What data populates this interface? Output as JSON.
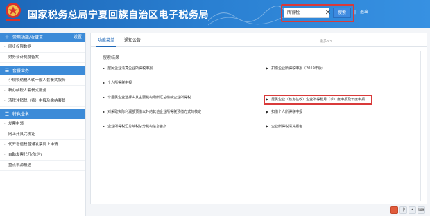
{
  "header": {
    "title": "国家税务总局宁夏回族自治区电子税务局",
    "search_value": "所得税",
    "search_button": "搜索",
    "user_links": [
      "|",
      "退出"
    ]
  },
  "sidebar": {
    "section1": {
      "title": "常用功能/收藏夹",
      "manage": "设置",
      "items": [
        "同步权限数据",
        "财务会计制度备案"
      ]
    },
    "section2": {
      "title": "套餐业务",
      "items": [
        "小规模纳税人转一般人套餐式服务",
        "新办纳税人套餐式服务",
        "清税注销税（费）申报及缴纳套餐"
      ]
    },
    "section3": {
      "title": "特色业务",
      "items": [
        "发票申领",
        "网上开具完税证",
        "代开增值税普通发票网上申请",
        "自助发票代开(航信)",
        "重点税源报送"
      ]
    }
  },
  "main": {
    "tabs": [
      "功能菜单",
      "通知公告"
    ],
    "more_link": "更多>>",
    "results_label": "搜索结果",
    "results": [
      "居民企业清算企业所得税申报",
      "扣缴企业所得税申报（2019年版）",
      "个人所得税申报",
      "居民企业（核定征收）企业所得税月（季）度申报及年度申报",
      "非居民企业选择由其主要机构场所汇总缴纳企业所得税",
      "扣缴个人所得税申报",
      "对采取实际利润额预缴以外的其他企业所得税预缴方式的核定",
      "企业所得税清算报备",
      "企业所得税汇总纳税总分机构信息备案"
    ]
  },
  "bottom_bar": [
    "",
    "中",
    "",
    ""
  ],
  "colors": {
    "header_blue": "#1d67b8",
    "highlight_red": "#d93a3a",
    "section_blue": "#3c8bd8"
  }
}
